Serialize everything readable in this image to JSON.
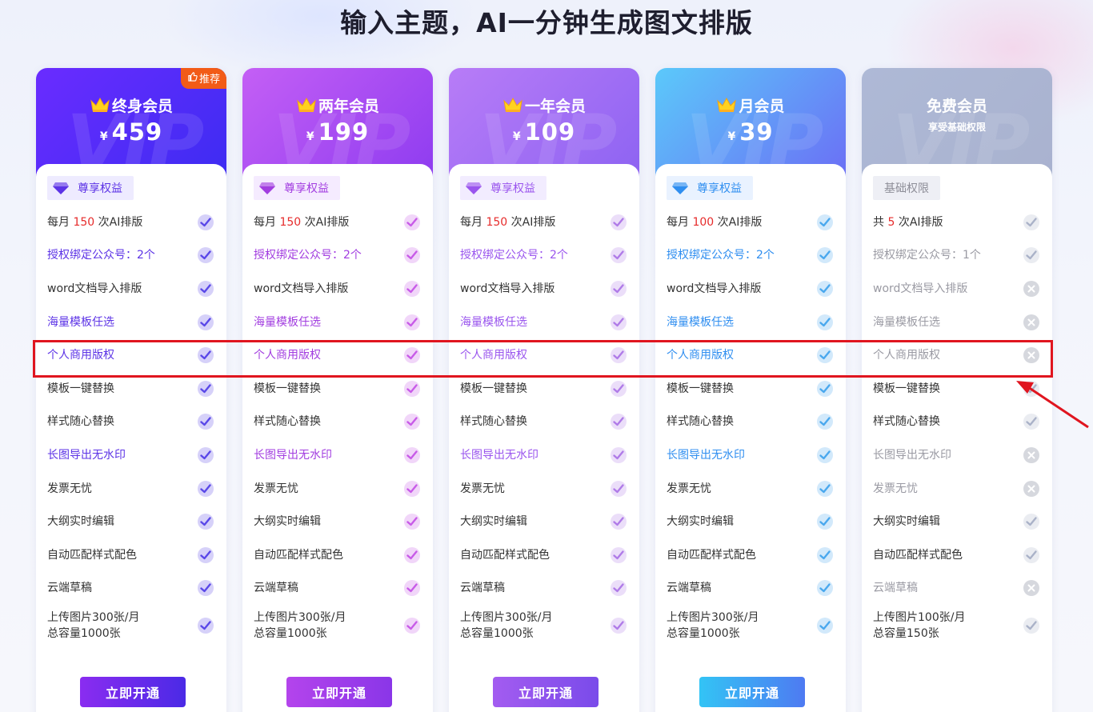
{
  "page_title": "输入主题，AI一分钟生成图文排版",
  "recommend_badge": "推荐",
  "currency_symbol": "¥",
  "watermark": "VIP",
  "plans": [
    {
      "name": "终身会员",
      "price": "459",
      "tag": "尊享权益",
      "button": "立即开通",
      "colors": {
        "head_from": "#6a2cff",
        "head_to": "#3d2cf2",
        "accent": "#5c33e6",
        "tag_bg": "#eeebff",
        "check": "#5a48e8",
        "btn_from": "#8a2cf0",
        "btn_to": "#4b2ae6"
      },
      "features": [
        {
          "pre": "每月 ",
          "num": "150",
          "post": " 次AI排版",
          "style": "normal",
          "check": "check"
        },
        {
          "pre": "授权绑定公众号：2个",
          "style": "accent",
          "check": "check"
        },
        {
          "pre": "word文档导入排版",
          "style": "normal",
          "check": "check"
        },
        {
          "pre": "海量模板任选",
          "style": "accent",
          "check": "check"
        },
        {
          "pre": "个人商用版权",
          "style": "accent",
          "check": "check"
        },
        {
          "pre": "模板一键替换",
          "style": "normal",
          "check": "check"
        },
        {
          "pre": "样式随心替换",
          "style": "normal",
          "check": "check"
        },
        {
          "pre": "长图导出无水印",
          "style": "accent",
          "check": "check"
        },
        {
          "pre": "发票无忧",
          "style": "normal",
          "check": "check"
        },
        {
          "pre": "大纲实时编辑",
          "style": "normal",
          "check": "check"
        },
        {
          "pre": "自动匹配样式配色",
          "style": "normal",
          "check": "check"
        },
        {
          "pre": "云端草稿",
          "style": "normal",
          "check": "check"
        },
        {
          "pre": "上传图片300张/月",
          "line2": "总容量1000张",
          "style": "normal",
          "check": "check"
        }
      ]
    },
    {
      "name": "两年会员",
      "price": "199",
      "tag": "尊享权益",
      "button": "立即开通",
      "colors": {
        "head_from": "#c45ff5",
        "head_to": "#8e3cf0",
        "accent": "#a23de0",
        "tag_bg": "#f5ebff",
        "check": "#c85be8",
        "btn_from": "#b444ec",
        "btn_to": "#8a36e8"
      },
      "features": [
        {
          "pre": "每月 ",
          "num": "150",
          "post": " 次AI排版",
          "style": "normal",
          "check": "check"
        },
        {
          "pre": "授权绑定公众号：2个",
          "style": "accent",
          "check": "check"
        },
        {
          "pre": "word文档导入排版",
          "style": "normal",
          "check": "check"
        },
        {
          "pre": "海量模板任选",
          "style": "accent",
          "check": "check"
        },
        {
          "pre": "个人商用版权",
          "style": "accent",
          "check": "check"
        },
        {
          "pre": "模板一键替换",
          "style": "normal",
          "check": "check"
        },
        {
          "pre": "样式随心替换",
          "style": "normal",
          "check": "check"
        },
        {
          "pre": "长图导出无水印",
          "style": "accent",
          "check": "check"
        },
        {
          "pre": "发票无忧",
          "style": "normal",
          "check": "check"
        },
        {
          "pre": "大纲实时编辑",
          "style": "normal",
          "check": "check"
        },
        {
          "pre": "自动匹配样式配色",
          "style": "normal",
          "check": "check"
        },
        {
          "pre": "云端草稿",
          "style": "normal",
          "check": "check"
        },
        {
          "pre": "上传图片300张/月",
          "line2": "总容量1000张",
          "style": "normal",
          "check": "check"
        }
      ]
    },
    {
      "name": "一年会员",
      "price": "109",
      "tag": "尊享权益",
      "button": "立即开通",
      "colors": {
        "head_from": "#b87cf7",
        "head_to": "#8d63f2",
        "accent": "#9a55ee",
        "tag_bg": "#f2ecff",
        "check": "#b07be8",
        "btn_from": "#a35cf0",
        "btn_to": "#7a4bea"
      },
      "features": [
        {
          "pre": "每月 ",
          "num": "150",
          "post": " 次AI排版",
          "style": "normal",
          "check": "check"
        },
        {
          "pre": "授权绑定公众号：2个",
          "style": "accent",
          "check": "check"
        },
        {
          "pre": "word文档导入排版",
          "style": "normal",
          "check": "check"
        },
        {
          "pre": "海量模板任选",
          "style": "accent",
          "check": "check"
        },
        {
          "pre": "个人商用版权",
          "style": "accent",
          "check": "check"
        },
        {
          "pre": "模板一键替换",
          "style": "normal",
          "check": "check"
        },
        {
          "pre": "样式随心替换",
          "style": "normal",
          "check": "check"
        },
        {
          "pre": "长图导出无水印",
          "style": "accent",
          "check": "check"
        },
        {
          "pre": "发票无忧",
          "style": "normal",
          "check": "check"
        },
        {
          "pre": "大纲实时编辑",
          "style": "normal",
          "check": "check"
        },
        {
          "pre": "自动匹配样式配色",
          "style": "normal",
          "check": "check"
        },
        {
          "pre": "云端草稿",
          "style": "normal",
          "check": "check"
        },
        {
          "pre": "上传图片300张/月",
          "line2": "总容量1000张",
          "style": "normal",
          "check": "check"
        }
      ]
    },
    {
      "name": "月会员",
      "price": "39",
      "tag": "尊享权益",
      "button": "立即开通",
      "colors": {
        "head_from": "#5bc9fa",
        "head_to": "#6b6ef5",
        "accent": "#2f8ef0",
        "tag_bg": "#e9f2ff",
        "check": "#4aa8ee",
        "btn_from": "#33c4f5",
        "btn_to": "#4e7af2"
      },
      "features": [
        {
          "pre": "每月 ",
          "num": "100",
          "post": " 次AI排版",
          "style": "normal",
          "check": "check"
        },
        {
          "pre": "授权绑定公众号：2个",
          "style": "accent",
          "check": "check"
        },
        {
          "pre": "word文档导入排版",
          "style": "normal",
          "check": "check"
        },
        {
          "pre": "海量模板任选",
          "style": "accent",
          "check": "check"
        },
        {
          "pre": "个人商用版权",
          "style": "accent",
          "check": "check"
        },
        {
          "pre": "模板一键替换",
          "style": "normal",
          "check": "check"
        },
        {
          "pre": "样式随心替换",
          "style": "normal",
          "check": "check"
        },
        {
          "pre": "长图导出无水印",
          "style": "accent",
          "check": "check"
        },
        {
          "pre": "发票无忧",
          "style": "normal",
          "check": "check"
        },
        {
          "pre": "大纲实时编辑",
          "style": "normal",
          "check": "check"
        },
        {
          "pre": "自动匹配样式配色",
          "style": "normal",
          "check": "check"
        },
        {
          "pre": "云端草稿",
          "style": "normal",
          "check": "check"
        },
        {
          "pre": "上传图片300张/月",
          "line2": "总容量1000张",
          "style": "normal",
          "check": "check"
        }
      ]
    },
    {
      "name": "免费会员",
      "subtitle": "享受基础权限",
      "tag": "基础权限",
      "colors": {
        "head_from": "#aeb9d6",
        "head_to": "#a9b2cf",
        "accent": "#8e8e98",
        "tag_bg": "#eeeff5",
        "check": "#aab2c8",
        "btn_from": "#ffffff",
        "btn_to": "#ffffff"
      },
      "features": [
        {
          "pre": "共 ",
          "num": "5",
          "post": " 次AI排版",
          "style": "normal",
          "check": "check"
        },
        {
          "pre": "授权绑定公众号：1个",
          "style": "muted",
          "check": "check"
        },
        {
          "pre": "word文档导入排版",
          "style": "muted",
          "check": "cross"
        },
        {
          "pre": "海量模板任选",
          "style": "muted",
          "check": "cross"
        },
        {
          "pre": "个人商用版权",
          "style": "muted",
          "check": "cross"
        },
        {
          "pre": "模板一键替换",
          "style": "normal",
          "check": "check"
        },
        {
          "pre": "样式随心替换",
          "style": "normal",
          "check": "check"
        },
        {
          "pre": "长图导出无水印",
          "style": "muted",
          "check": "cross"
        },
        {
          "pre": "发票无忧",
          "style": "muted",
          "check": "cross"
        },
        {
          "pre": "大纲实时编辑",
          "style": "normal",
          "check": "check"
        },
        {
          "pre": "自动匹配样式配色",
          "style": "normal",
          "check": "check"
        },
        {
          "pre": "云端草稿",
          "style": "muted",
          "check": "cross"
        },
        {
          "pre": "上传图片100张/月",
          "line2": "总容量150张",
          "style": "normal",
          "check": "check"
        }
      ]
    }
  ]
}
